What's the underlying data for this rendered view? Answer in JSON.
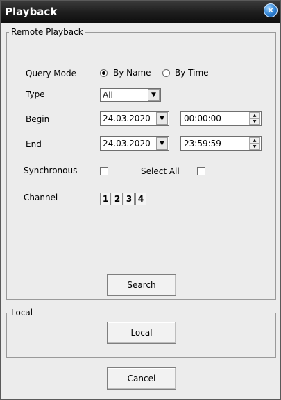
{
  "window": {
    "title": "Playback",
    "close_glyph": "✕"
  },
  "remote": {
    "legend": "Remote Playback",
    "query_mode_label": "Query Mode",
    "by_name": "By Name",
    "by_time": "By Time",
    "selected_mode": "By Name",
    "type_label": "Type",
    "type_value": "All",
    "begin_label": "Begin",
    "begin_date": "24.03.2020",
    "begin_time": "00:00:00",
    "end_label": "End",
    "end_date": "24.03.2020",
    "end_time": "23:59:59",
    "synchronous_label": "Synchronous",
    "synchronous_checked": false,
    "select_all_label": "Select All",
    "select_all_checked": false,
    "channel_label": "Channel",
    "channels": [
      "1",
      "2",
      "3",
      "4"
    ],
    "search_label": "Search"
  },
  "local": {
    "legend": "Local",
    "button_label": "Local"
  },
  "footer": {
    "cancel_label": "Cancel"
  },
  "icons": {
    "close": "close-icon",
    "dropdown": "chevron-down-icon",
    "spin_up": "spin-up-icon",
    "spin_down": "spin-down-icon"
  },
  "colors": {
    "title_bar": "#1d1d1d",
    "close_button": "#2d7fd0",
    "window_bg": "#ececec"
  }
}
